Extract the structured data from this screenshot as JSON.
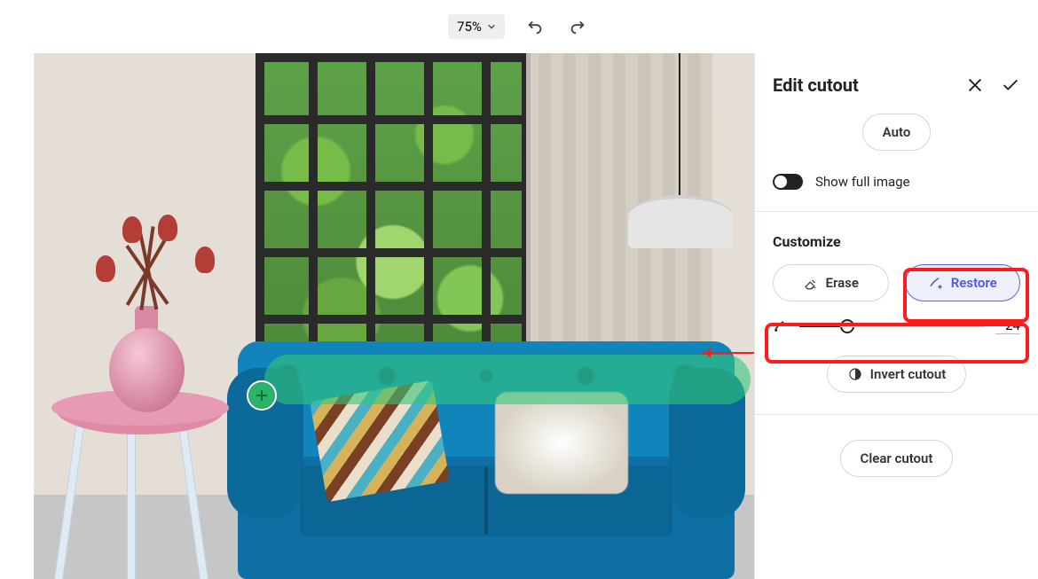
{
  "toolbar": {
    "zoom": "75%"
  },
  "panel": {
    "title": "Edit cutout",
    "auto_label": "Auto",
    "show_full_label": "Show full image",
    "show_full_on": false,
    "customize_label": "Customize",
    "erase_label": "Erase",
    "restore_label": "Restore",
    "brush_size": "24",
    "invert_label": "Invert cutout",
    "clear_label": "Clear cutout"
  }
}
